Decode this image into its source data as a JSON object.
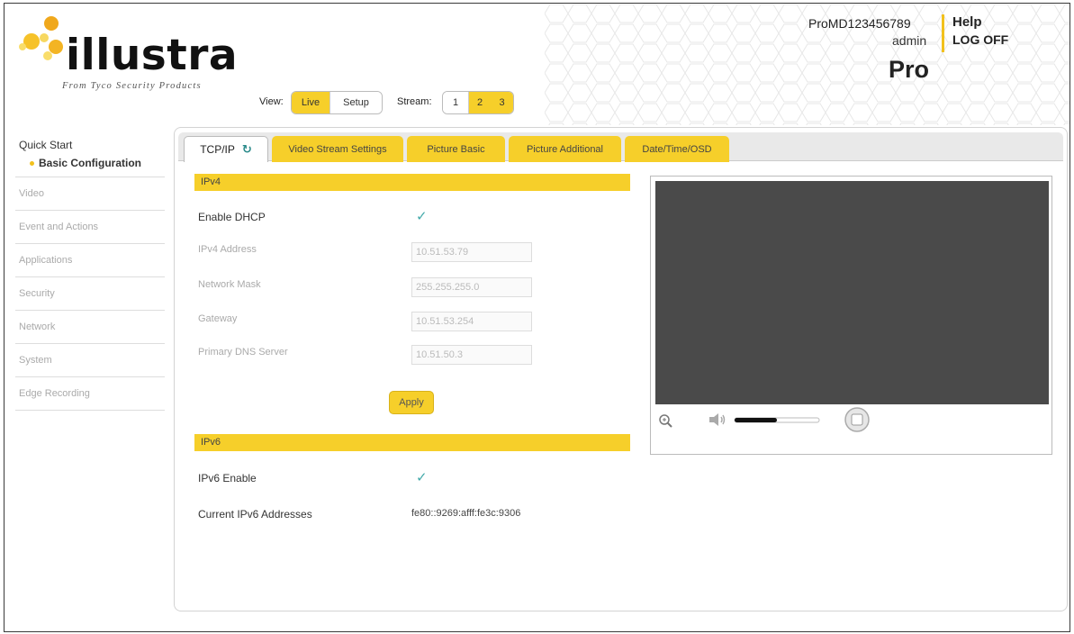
{
  "brand": {
    "logo_text": "illustra",
    "tagline": "From Tyco Security Products"
  },
  "view": {
    "label": "View:",
    "options": [
      "Live",
      "Setup"
    ],
    "selected": "Live"
  },
  "stream": {
    "label": "Stream:",
    "options": [
      "1",
      "2",
      "3"
    ],
    "selected": "1"
  },
  "user": {
    "device_id": "ProMD123456789",
    "username": "admin",
    "help": "Help",
    "logoff": "LOG OFF",
    "product": "Pro"
  },
  "sidebar": {
    "section": "Quick Start",
    "active_item": "Basic Configuration",
    "items": [
      "Video",
      "Event and Actions",
      "Applications",
      "Security",
      "Network",
      "System",
      "Edge Recording"
    ]
  },
  "tabs": [
    "TCP/IP",
    "Video Stream Settings",
    "Picture Basic",
    "Picture Additional",
    "Date/Time/OSD"
  ],
  "ipv4": {
    "title": "IPv4",
    "enable_dhcp_label": "Enable DHCP",
    "enable_dhcp_checked": true,
    "fields": [
      {
        "label": "IPv4 Address",
        "value": "10.51.53.79"
      },
      {
        "label": "Network Mask",
        "value": "255.255.255.0"
      },
      {
        "label": "Gateway",
        "value": "10.51.53.254"
      },
      {
        "label": "Primary DNS Server",
        "value": "10.51.50.3"
      }
    ],
    "apply_label": "Apply"
  },
  "ipv6": {
    "title": "IPv6",
    "enable_label": "IPv6 Enable",
    "enable_checked": true,
    "addresses_label": "Current IPv6 Addresses",
    "addresses_value": "fe80::9269:afff:fe3c:9306"
  },
  "colors": {
    "accent": "#f6cf2a",
    "video_bg": "#4a4a4a"
  },
  "player": {
    "volume": 0.5,
    "icons": [
      "zoom-icon",
      "speaker-icon",
      "volume-slider",
      "stop-icon"
    ]
  }
}
